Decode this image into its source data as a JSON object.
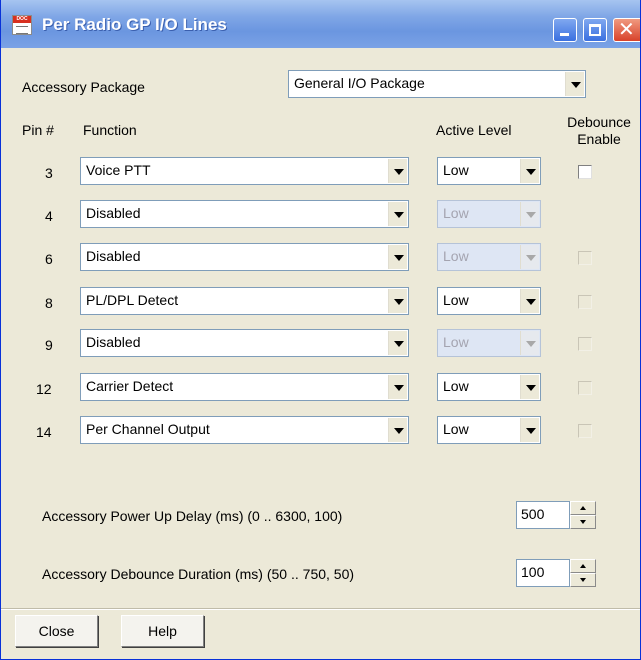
{
  "window": {
    "title": "Per Radio GP I/O Lines",
    "icon_text": "DOC"
  },
  "accessory": {
    "label": "Accessory Package",
    "value": "General I/O Package"
  },
  "headers": {
    "pin": "Pin #",
    "function": "Function",
    "active_level": "Active Level",
    "debounce_line1": "Debounce",
    "debounce_line2": "Enable"
  },
  "rows": [
    {
      "pin": "3",
      "function": "Voice PTT",
      "level": "Low",
      "level_enabled": true,
      "debounce": "enabled-unchecked"
    },
    {
      "pin": "4",
      "function": "Disabled",
      "level": "Low",
      "level_enabled": false,
      "debounce": "hidden"
    },
    {
      "pin": "6",
      "function": "Disabled",
      "level": "Low",
      "level_enabled": false,
      "debounce": "disabled-unchecked"
    },
    {
      "pin": "8",
      "function": "PL/DPL Detect",
      "level": "Low",
      "level_enabled": true,
      "debounce": "disabled-unchecked"
    },
    {
      "pin": "9",
      "function": "Disabled",
      "level": "Low",
      "level_enabled": false,
      "debounce": "disabled-unchecked"
    },
    {
      "pin": "12",
      "function": "Carrier Detect",
      "level": "Low",
      "level_enabled": true,
      "debounce": "disabled-unchecked"
    },
    {
      "pin": "14",
      "function": "Per Channel Output",
      "level": "Low",
      "level_enabled": true,
      "debounce": "disabled-unchecked"
    }
  ],
  "power_up_delay": {
    "label": "Accessory Power Up Delay (ms) (0 .. 6300, 100)",
    "value": "500"
  },
  "debounce_duration": {
    "label": "Accessory Debounce Duration (ms) (50 .. 750, 50)",
    "value": "100"
  },
  "buttons": {
    "close": "Close",
    "help": "Help"
  },
  "colors": {
    "titlebar": "#7aa2e6",
    "dialog_bg": "#ece9d8",
    "disabled_combo": "#dee6f4"
  }
}
